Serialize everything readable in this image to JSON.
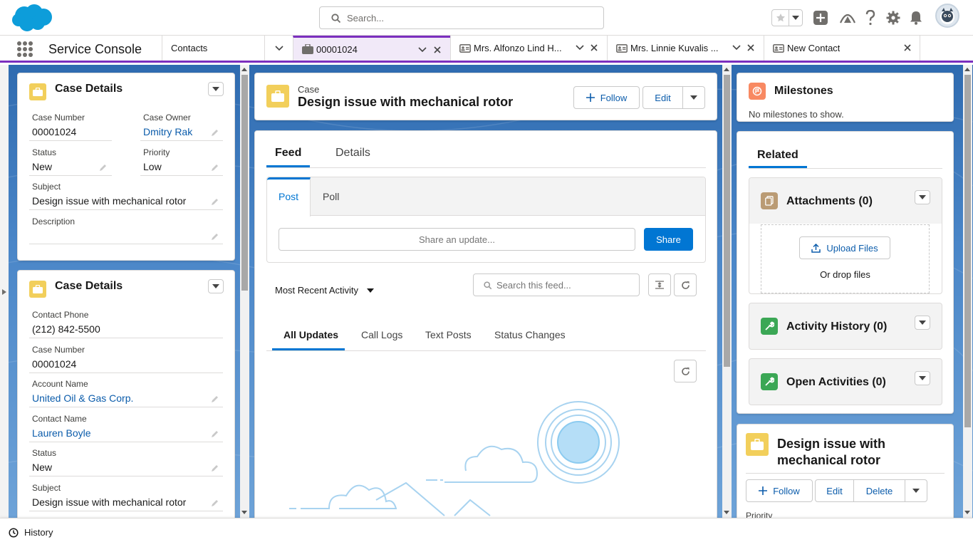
{
  "header": {
    "search_placeholder": "Search...",
    "icons": [
      "favorites-star-icon",
      "add-icon",
      "trailhead-icon",
      "help-icon",
      "setup-gear-icon",
      "notifications-bell-icon"
    ]
  },
  "console_nav": {
    "app_name": "Service Console",
    "tabs": [
      {
        "label": "Contacts",
        "icon": "none",
        "active": false
      },
      {
        "label": "00001024",
        "icon": "case-icon",
        "active": true
      },
      {
        "label": "Mrs. Alfonzo Lind H...",
        "icon": "contact-card-icon",
        "active": false
      },
      {
        "label": "Mrs. Linnie Kuvalis ...",
        "icon": "contact-card-icon",
        "active": false
      },
      {
        "label": "New Contact",
        "icon": "contact-card-icon",
        "active": false
      }
    ]
  },
  "left": {
    "card1": {
      "title": "Case Details",
      "case_number_label": "Case Number",
      "case_number": "00001024",
      "case_owner_label": "Case Owner",
      "case_owner": "Dmitry Rak",
      "status_label": "Status",
      "status": "New",
      "priority_label": "Priority",
      "priority": "Low",
      "subject_label": "Subject",
      "subject": "Design issue with mechanical rotor",
      "description_label": "Description",
      "description": ""
    },
    "card2": {
      "title": "Case Details",
      "contact_phone_label": "Contact Phone",
      "contact_phone": "(212) 842-5500",
      "case_number_label": "Case Number",
      "case_number": "00001024",
      "account_name_label": "Account Name",
      "account_name": "United Oil & Gas Corp.",
      "contact_name_label": "Contact Name",
      "contact_name": "Lauren Boyle",
      "status_label": "Status",
      "status": "New",
      "subject_label": "Subject",
      "subject": "Design issue with mechanical rotor"
    }
  },
  "center": {
    "record_type": "Case",
    "record_title": "Design issue with mechanical rotor",
    "follow_label": "Follow",
    "edit_label": "Edit",
    "tabs": [
      "Feed",
      "Details"
    ],
    "publisher_tabs": [
      "Post",
      "Poll"
    ],
    "share_placeholder": "Share an update...",
    "share_label": "Share",
    "sort_label": "Most Recent Activity",
    "feed_search_placeholder": "Search this feed...",
    "filter_tabs": [
      "All Updates",
      "Call Logs",
      "Text Posts",
      "Status Changes"
    ]
  },
  "right": {
    "milestones_title": "Milestones",
    "milestones_empty": "No milestones to show.",
    "related_tab": "Related",
    "attachments_title": "Attachments (0)",
    "upload_label": "Upload Files",
    "drop_label": "Or drop files",
    "activity_history_title": "Activity History (0)",
    "open_activities_title": "Open Activities (0)",
    "highlight_title": "Design issue with mechanical rotor",
    "highlight_follow": "Follow",
    "highlight_edit": "Edit",
    "highlight_delete": "Delete",
    "highlight_priority_label": "Priority"
  },
  "footer": {
    "history_label": "History"
  },
  "colors": {
    "brand_blue": "#0176d3",
    "link_blue": "#0b5cab",
    "console_accent": "#7b2fbe",
    "case_icon": "#f2cf5b"
  }
}
